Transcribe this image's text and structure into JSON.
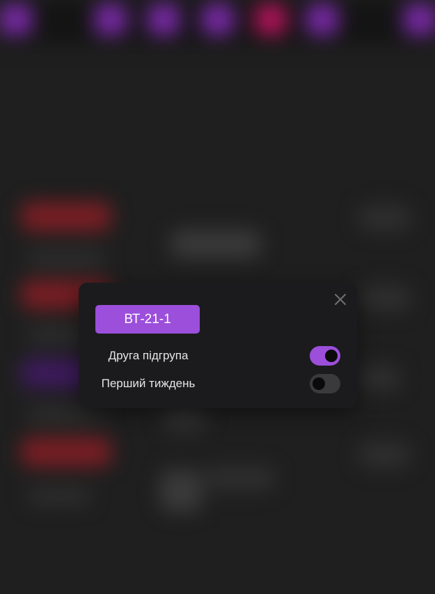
{
  "dialog": {
    "group_button_label": "ВТ-21-1",
    "close_icon": "close-icon",
    "settings": [
      {
        "label": "Друга підгрупа",
        "enabled": true
      },
      {
        "label": "Перший тиждень",
        "enabled": false
      }
    ]
  },
  "colors": {
    "accent": "#9b4fdb",
    "dialog_background": "#1b1b1d",
    "page_background": "#1f1f1f",
    "toggle_off": "#3a3a3c"
  }
}
